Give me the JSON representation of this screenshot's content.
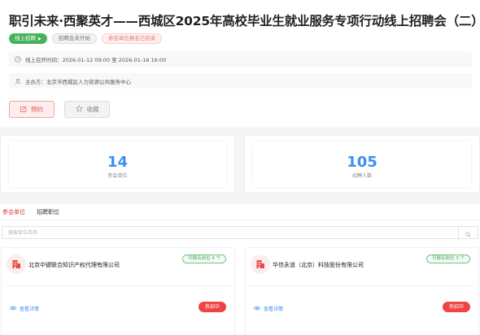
{
  "event": {
    "title": "职引未来·西聚英才——西城区2025年高校毕业生就业服务专项行动线上招聘会（二）",
    "tags": {
      "online": "线上招聘",
      "not_started": "招聘会未开始",
      "signup_ended": "参会单位报名已结束"
    },
    "time_label": "线上召开时间：",
    "time_value": "2026-01-12 09:00 至 2026-01-16 16:00",
    "organizer_label": "主办方：",
    "organizer_value": "北京市西城区人力资源公共服务中心",
    "reserve_button": "预约",
    "favorite_button": "收藏"
  },
  "stats": {
    "units": {
      "value": "14",
      "label": "参会单位"
    },
    "people": {
      "value": "105",
      "label": "招聘人数"
    }
  },
  "tabs": {
    "units": "参会单位",
    "positions": "招聘职位"
  },
  "search": {
    "placeholder": "搜索单位名称",
    "value": ""
  },
  "companies": [
    {
      "name": "北京中键联合知识产权代理有限公司",
      "positions_badge": "可报名岗位 4 个",
      "detail_link": "查看详情",
      "hot_badge": "热招中"
    },
    {
      "name": "华信永道（北京）科技股份有限公司",
      "positions_badge": "可报名岗位 3 个",
      "detail_link": "查看详情",
      "hot_badge": "热招中"
    }
  ],
  "colors": {
    "accent_red": "#e0393e",
    "accent_blue": "#3f8ef0",
    "accent_green": "#46b35c"
  },
  "icons": {
    "time": "clock-icon",
    "organizer": "user-icon",
    "reserve": "calendar-edit-icon",
    "favorite": "star-icon",
    "search": "search-icon",
    "company": "building-icon",
    "detail": "eye-icon"
  }
}
